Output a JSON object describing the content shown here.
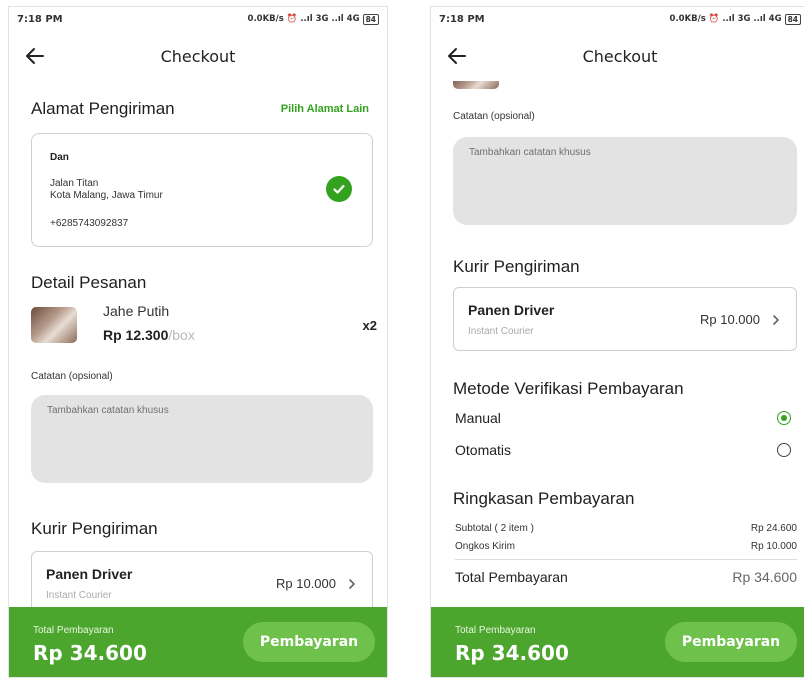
{
  "status_bar": {
    "time": "7:18 PM",
    "right_left": "0.0KB/s ⏰ ..ıl 3G ..ıl 4G",
    "battery_left": "84",
    "right_right": "0.0KB/s ⏰ ..ıl 3G ..ıl 4G",
    "battery_right": "84"
  },
  "app_bar": {
    "title": "Checkout",
    "back_icon": "arrow-left-icon"
  },
  "address": {
    "title": "Alamat Pengiriman",
    "change_link": "Pilih Alamat Lain",
    "name": "Dan",
    "street": "Jalan Titan",
    "city": "Kota Malang, Jawa Timur",
    "phone": "+6285743092837",
    "selected_icon": "check-circle-icon"
  },
  "order": {
    "title": "Detail Pesanan",
    "product_name": "Jahe Putih",
    "price": "Rp 12.300",
    "unit": "/box",
    "qty": "x2"
  },
  "note": {
    "label": "Catatan (opsional)",
    "placeholder": "Tambahkan catatan khusus"
  },
  "courier": {
    "title": "Kurir Pengiriman",
    "name": "Panen Driver",
    "type": "Instant Courier",
    "price": "Rp 10.000"
  },
  "verification": {
    "title": "Metode Verifikasi Pembayaran",
    "options": [
      {
        "label": "Manual",
        "selected": true
      },
      {
        "label": "Otomatis",
        "selected": false
      }
    ]
  },
  "summary": {
    "title": "Ringkasan Pembayaran",
    "subtotal_label": "Subtotal ( 2 item )",
    "subtotal_value": "Rp 24.600",
    "shipping_label": "Ongkos Kirim",
    "shipping_value": "Rp 10.000",
    "total_label": "Total Pembayaran",
    "total_value": "Rp 34.600"
  },
  "bottom_bar": {
    "label": "Total Pembayaran",
    "amount": "Rp 34.600",
    "pay_button": "Pembayaran"
  },
  "colors": {
    "accent": "#4ca52d",
    "accent_light": "#6ec24c",
    "link": "#33a31f",
    "note_bg": "#e3e3e3"
  }
}
